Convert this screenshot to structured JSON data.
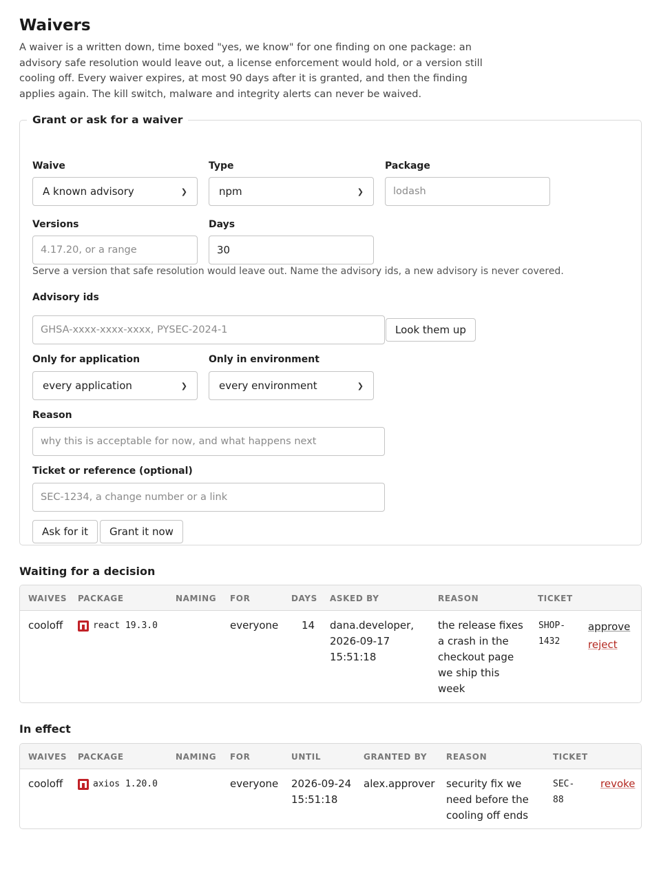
{
  "page": {
    "title": "Waivers",
    "intro": "A waiver is a written down, time boxed \"yes, we know\" for one finding on one package: an advisory safe resolution would leave out, a license enforcement would hold, or a version still cooling off. Every waiver expires, at most 90 days after it is granted, and then the finding applies again. The kill switch, malware and integrity alerts can never be waived."
  },
  "form": {
    "legend": "Grant or ask for a waiver",
    "waive": {
      "label": "Waive",
      "value": "A known advisory"
    },
    "type": {
      "label": "Type",
      "value": "npm"
    },
    "package": {
      "label": "Package",
      "placeholder": "lodash"
    },
    "versions": {
      "label": "Versions",
      "placeholder": "4.17.20, or a range"
    },
    "days": {
      "label": "Days",
      "value": "30"
    },
    "hint": "Serve a version that safe resolution would leave out. Name the advisory ids, a new advisory is never covered.",
    "advisory_ids": {
      "label": "Advisory ids",
      "placeholder": "GHSA-xxxx-xxxx-xxxx, PYSEC-2024-1"
    },
    "lookup_button": "Look them up",
    "application": {
      "label": "Only for application",
      "value": "every application"
    },
    "environment": {
      "label": "Only in environment",
      "value": "every environment"
    },
    "reason": {
      "label": "Reason",
      "placeholder": "why this is acceptable for now, and what happens next"
    },
    "ticket": {
      "label": "Ticket or reference (optional)",
      "placeholder": "SEC-1234, a change number or a link"
    },
    "ask_button": "Ask for it",
    "grant_button": "Grant it now"
  },
  "pending": {
    "heading": "Waiting for a decision",
    "columns": [
      "WAIVES",
      "PACKAGE",
      "NAMING",
      "FOR",
      "DAYS",
      "ASKED BY",
      "REASON",
      "TICKET"
    ],
    "rows": [
      {
        "waives": "cooloff",
        "package_icon": "npm-icon",
        "package": "react 19.3.0",
        "naming": "",
        "for": "everyone",
        "days": "14",
        "asked_by_1": "dana.developer,",
        "asked_by_2": "2026-09-17",
        "asked_by_3": "15:51:18",
        "reason_1": "the release fixes",
        "reason_2": "a crash in the",
        "reason_3": "checkout page",
        "reason_4": "we ship this",
        "reason_5": "week",
        "ticket_1": "SHOP-",
        "ticket_2": "1432",
        "approve": "approve",
        "reject": "reject"
      }
    ]
  },
  "active": {
    "heading": "In effect",
    "columns": [
      "WAIVES",
      "PACKAGE",
      "NAMING",
      "FOR",
      "UNTIL",
      "GRANTED BY",
      "REASON",
      "TICKET"
    ],
    "rows": [
      {
        "waives": "cooloff",
        "package_icon": "npm-icon",
        "package": "axios 1.20.0",
        "naming": "",
        "for": "everyone",
        "until_1": "2026-09-24",
        "until_2": "15:51:18",
        "granted_by": "alex.approver",
        "reason_1": "security fix we",
        "reason_2": "need before the",
        "reason_3": "cooling off ends",
        "ticket_1": "SEC-",
        "ticket_2": "88",
        "revoke": "revoke"
      }
    ]
  },
  "colors": {
    "link_red": "#b3261e",
    "npm_red": "#c12127",
    "border": "#d9d9d9"
  }
}
